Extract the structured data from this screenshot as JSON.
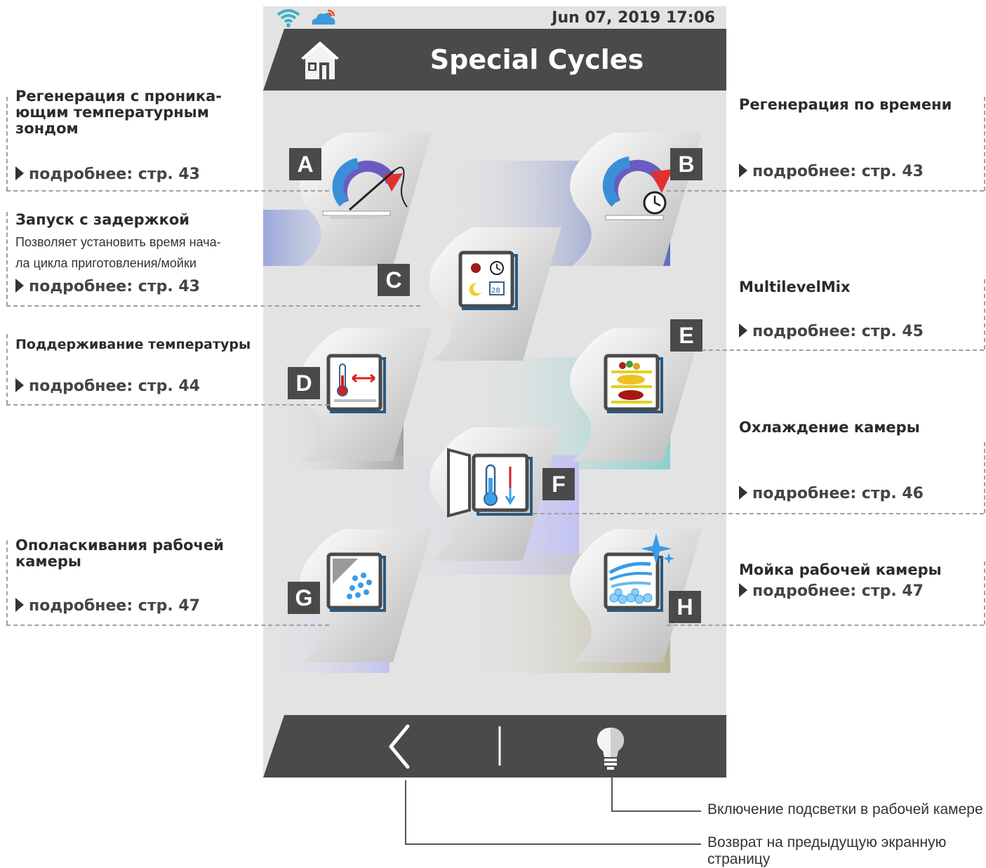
{
  "status": {
    "datetime": "Jun 07, 2019  17:06",
    "wifi_color": "#3ab0c8",
    "cloud_color": "#3a9bd8",
    "cloud_accent": "#e8502a"
  },
  "header": {
    "title": "Special Cycles",
    "bg_color": "#4a4a4a"
  },
  "tiles": [
    {
      "letter": "A",
      "icon": "probe-regeneration-icon"
    },
    {
      "letter": "B",
      "icon": "timed-regeneration-icon"
    },
    {
      "letter": "C",
      "icon": "delayed-start-icon"
    },
    {
      "letter": "D",
      "icon": "hold-temperature-icon"
    },
    {
      "letter": "E",
      "icon": "multilevel-mix-icon"
    },
    {
      "letter": "F",
      "icon": "chamber-cooling-icon"
    },
    {
      "letter": "G",
      "icon": "chamber-rinse-icon"
    },
    {
      "letter": "H",
      "icon": "chamber-wash-icon"
    }
  ],
  "annotations": {
    "a": {
      "title_lines": [
        "Регенерация с проника-",
        "ющим температурным",
        "зондом"
      ],
      "link": "подробнее: стр. 43"
    },
    "b": {
      "title": "Регенерация по времени",
      "link": "подробнее: стр. 43"
    },
    "c": {
      "title": "Запуск с задержкой",
      "desc_lines": [
        "Позволяет установить время нача-",
        "ла цикла приготовления/мойки"
      ],
      "link": "подробнее: стр. 43"
    },
    "d": {
      "title": "Поддерживание температуры",
      "link": "подробнее: стр. 44"
    },
    "e": {
      "title": "MultilevelMix",
      "link": "подробнее: стр. 45"
    },
    "f": {
      "title": "Охлаждение камеры",
      "link": "подробнее: стр. 46"
    },
    "g": {
      "title_lines": [
        "Ополаскивания рабочей",
        "камеры"
      ],
      "link": "подробнее: стр. 47"
    },
    "h": {
      "title": "Мойка рабочей камеры",
      "link": "подробнее: стр. 47"
    }
  },
  "footer": {
    "light_label": "Включение подсветки в рабочей камере",
    "back_label": "Возврат на предыдущую экранную страницу"
  }
}
